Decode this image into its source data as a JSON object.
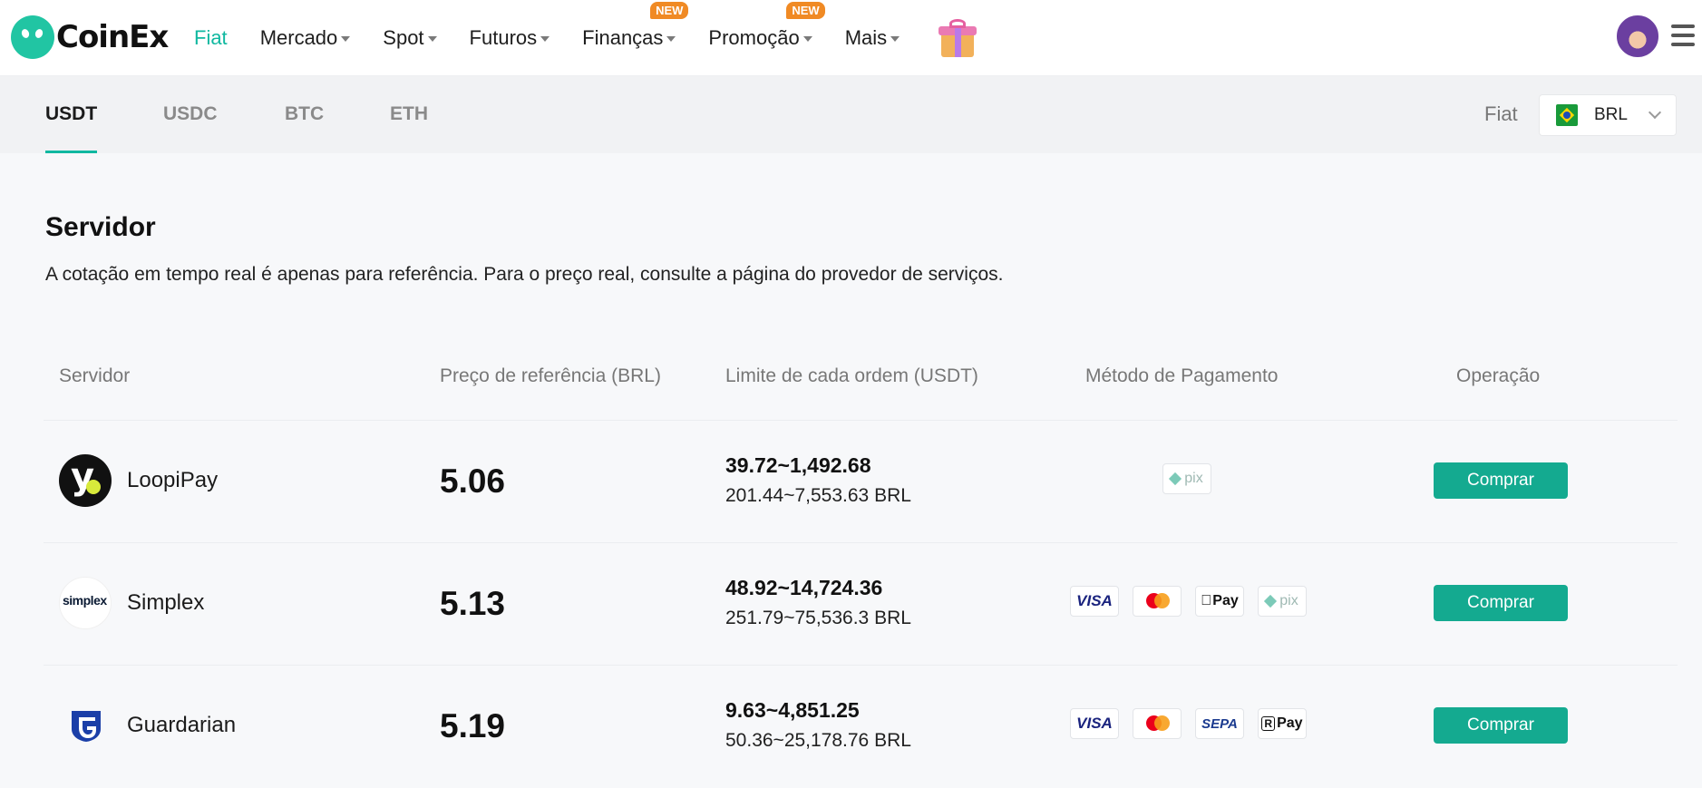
{
  "brand": {
    "name": "CoinEx"
  },
  "nav": {
    "items": [
      {
        "label": "Fiat",
        "active": true,
        "dropdown": false,
        "badge": ""
      },
      {
        "label": "Mercado",
        "active": false,
        "dropdown": true,
        "badge": ""
      },
      {
        "label": "Spot",
        "active": false,
        "dropdown": true,
        "badge": ""
      },
      {
        "label": "Futuros",
        "active": false,
        "dropdown": true,
        "badge": ""
      },
      {
        "label": "Finanças",
        "active": false,
        "dropdown": true,
        "badge": "NEW"
      },
      {
        "label": "Promoção",
        "active": false,
        "dropdown": true,
        "badge": "NEW"
      },
      {
        "label": "Mais",
        "active": false,
        "dropdown": true,
        "badge": ""
      }
    ],
    "icons": [
      "gift-icon",
      "avatar",
      "hamburger-menu-icon"
    ]
  },
  "tabs": [
    {
      "label": "USDT",
      "active": true
    },
    {
      "label": "USDC",
      "active": false
    },
    {
      "label": "BTC",
      "active": false
    },
    {
      "label": "ETH",
      "active": false
    }
  ],
  "fiat_selector": {
    "label": "Fiat",
    "value": "BRL",
    "flag_icon": "brazil-flag-icon"
  },
  "section": {
    "title": "Servidor",
    "description": "A cotação em tempo real é apenas para referência. Para o preço real, consulte a página do provedor de serviços."
  },
  "table": {
    "headers": [
      "Servidor",
      "Preço de referência (BRL)",
      "Limite de cada ordem (USDT)",
      "Método de Pagamento",
      "Operação"
    ],
    "rows": [
      {
        "provider": "LoopiPay",
        "logo": "loopipay-logo",
        "price": "5.06",
        "limit_usdt": "39.72~1,492.68",
        "limit_brl": "201.44~7,553.63 BRL",
        "payments": [
          "pix"
        ],
        "action": "Comprar"
      },
      {
        "provider": "Simplex",
        "logo": "simplex-logo",
        "logo_text": "simplex",
        "price": "5.13",
        "limit_usdt": "48.92~14,724.36",
        "limit_brl": "251.79~75,536.3 BRL",
        "payments": [
          "visa",
          "mastercard",
          "apple-pay",
          "pix"
        ],
        "action": "Comprar"
      },
      {
        "provider": "Guardarian",
        "logo": "guardarian-logo",
        "price": "5.19",
        "limit_usdt": "9.63~4,851.25",
        "limit_brl": "50.36~25,178.76 BRL",
        "payments": [
          "visa",
          "mastercard",
          "sepa",
          "revolut-pay"
        ],
        "action": "Comprar"
      }
    ]
  },
  "payment_labels": {
    "visa": "VISA",
    "apple": "Pay",
    "sepa": "SEPA",
    "rpay": "Pay",
    "pix": "pix"
  },
  "colors": {
    "accent": "#10b8a0",
    "buy_button": "#14aa90",
    "new_badge": "#f08a24"
  }
}
